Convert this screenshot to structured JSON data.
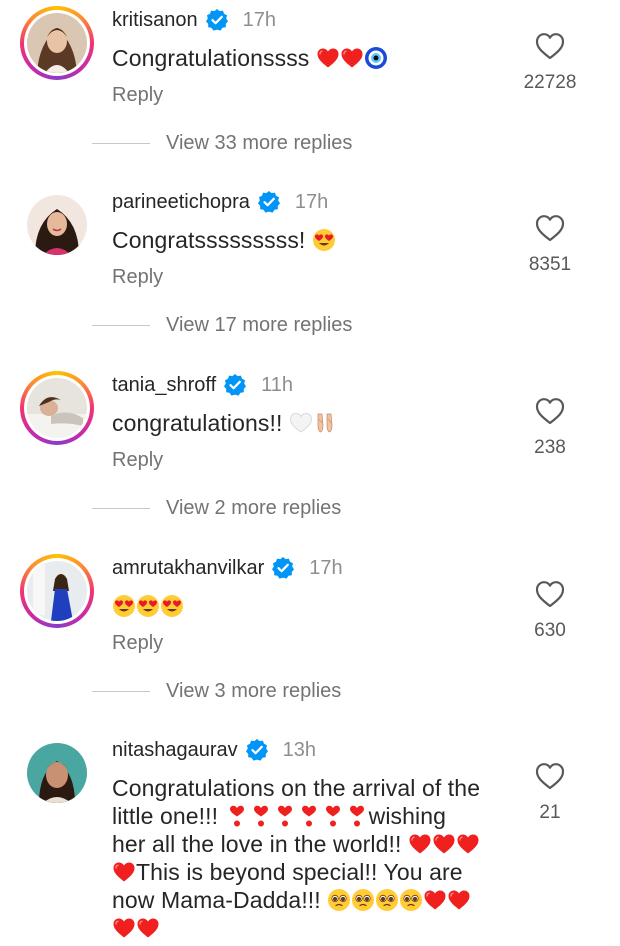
{
  "comments": [
    {
      "username": "kritisanon",
      "time": "17h",
      "text": "Congratulationssss",
      "reply_label": "Reply",
      "likes": "22728",
      "view_more": "View 33 more replies"
    },
    {
      "username": "parineetichopra",
      "time": "17h",
      "text": "Congratsssssssss!",
      "reply_label": "Reply",
      "likes": "8351",
      "view_more": "View 17 more replies"
    },
    {
      "username": "tania_shroff",
      "time": "11h",
      "text": "congratulations!!",
      "reply_label": "Reply",
      "likes": "238",
      "view_more": "View 2 more replies"
    },
    {
      "username": "amrutakhanvilkar",
      "time": "17h",
      "text": "",
      "reply_label": "Reply",
      "likes": "630",
      "view_more": "View 3 more replies"
    },
    {
      "username": "nitashagaurav",
      "time": "13h",
      "text_line1": "Congratulations on the arrival of the",
      "text_line2a": "little one!!!",
      "text_line2b": "wishing",
      "text_line3": "her all the love in the world!!",
      "text_line4": "This is beyond special!! You are",
      "text_line5": "now Mama-Dadda!!!",
      "likes": "21"
    }
  ],
  "icons": {
    "heart_outline": "heart-outline-icon",
    "verified_badge": "verified-badge-icon"
  },
  "colors": {
    "verified_blue": "#0095f6",
    "heart_red": "#f0201f",
    "muted_text": "#737373"
  }
}
